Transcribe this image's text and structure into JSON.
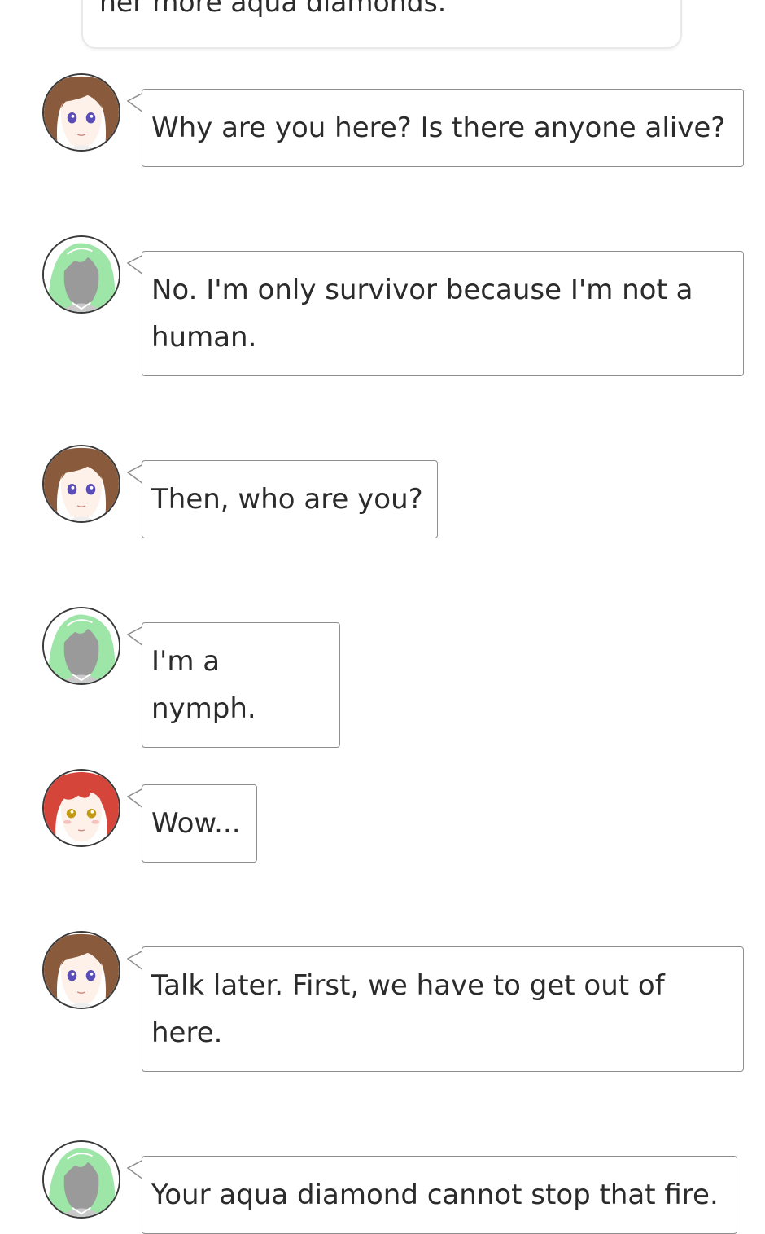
{
  "narration": {
    "text": "her more aqua diamonds."
  },
  "messages": [
    {
      "speaker": "brown-hair-girl",
      "text": "Why are you here? Is there anyone alive?"
    },
    {
      "speaker": "green-hair-nymph",
      "text": "No. I'm only survivor because I'm not a human."
    },
    {
      "speaker": "brown-hair-girl",
      "text": "Then, who are you?"
    },
    {
      "speaker": "green-hair-nymph",
      "text": "I'm a nymph."
    },
    {
      "speaker": "red-hair-girl",
      "text": "Wow..."
    },
    {
      "speaker": "brown-hair-girl",
      "text": "Talk later. First, we have to get out of here."
    },
    {
      "speaker": "green-hair-nymph",
      "text": "Your aqua diamond cannot stop that fire."
    }
  ],
  "colors": {
    "bubble_border": "#8e8e8e",
    "brown_hair": "#8a5a3c",
    "green_hair": "#9ee6a8",
    "red_hair": "#d6453a",
    "purple_eyes": "#5a4db8",
    "gold_eyes": "#c49a12"
  }
}
